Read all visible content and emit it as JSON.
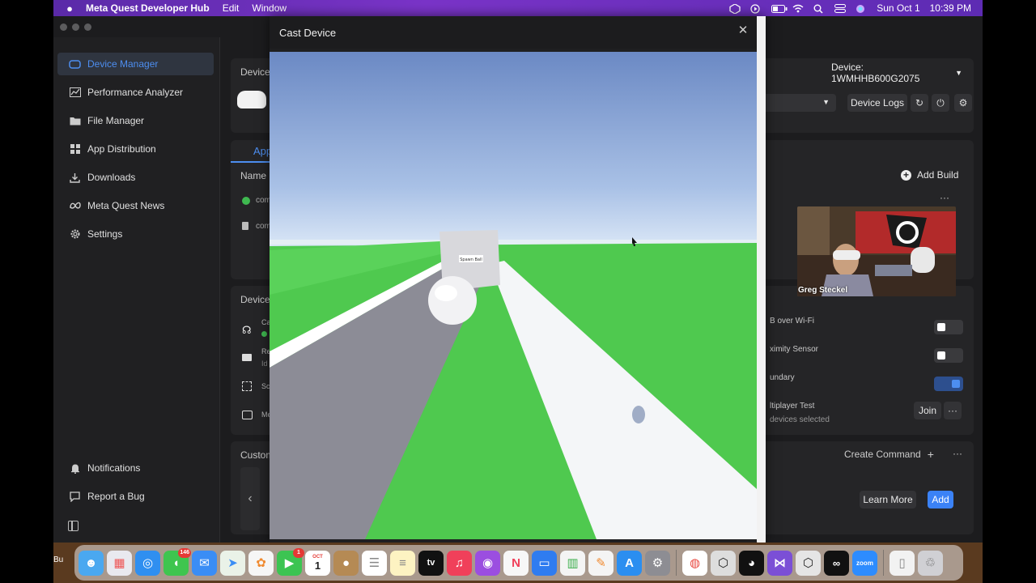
{
  "menubar": {
    "app_name": "Meta Quest Developer Hub",
    "menus": [
      "Edit",
      "Window"
    ],
    "date": "Sun Oct 1",
    "time": "10:39 PM"
  },
  "sidebar": {
    "items": [
      {
        "label": "Device Manager",
        "icon": "headset-icon",
        "active": true
      },
      {
        "label": "Performance Analyzer",
        "icon": "chart-icon"
      },
      {
        "label": "File Manager",
        "icon": "folder-icon"
      },
      {
        "label": "App Distribution",
        "icon": "grid-icon"
      },
      {
        "label": "Downloads",
        "icon": "download-icon"
      },
      {
        "label": "Meta Quest News",
        "icon": "meta-icon"
      },
      {
        "label": "Settings",
        "icon": "gear-icon"
      }
    ],
    "bottom_items": [
      {
        "label": "Notifications",
        "icon": "bell-icon"
      },
      {
        "label": "Report a Bug",
        "icon": "bug-icon"
      }
    ]
  },
  "device_header": {
    "label": "Device",
    "device_select": "Device: 1WMHHB600G2075",
    "device_logs": "Device Logs"
  },
  "apps_panel": {
    "tab_label": "App",
    "column_name": "Name",
    "rows": [
      "com",
      "com"
    ],
    "add_build": "Add Build"
  },
  "device_actions": {
    "label": "Device",
    "rows": [
      {
        "label": "Ca",
        "icon": "cast-icon"
      },
      {
        "label": "Re",
        "sub": "Id",
        "icon": "record-icon"
      },
      {
        "label": "Sc",
        "icon": "screenshot-icon"
      },
      {
        "label": "Me",
        "icon": "media-icon"
      }
    ]
  },
  "settings_rows": {
    "adb_wifi": "B over Wi-Fi",
    "proximity": "ximity Sensor",
    "boundary": "undary",
    "multiplayer": "ltiplayer Test",
    "multiplayer_sub": "devices selected",
    "join": "Join",
    "toggles": [
      false,
      false,
      true
    ]
  },
  "custom_commands": {
    "label": "Custom",
    "create_command": "Create Command",
    "learn_more": "Learn More",
    "add": "Add"
  },
  "cast_modal": {
    "title": "Cast Device",
    "sign_text": "Spawn Ball"
  },
  "webcam": {
    "name": "Greg Steckel"
  },
  "dock": {
    "left_label": "Bu",
    "calendar_month": "OCT",
    "calendar_day": "1",
    "messages_badge": "146",
    "facetime_badge": "1",
    "tv_label": "tv",
    "zoom_label": "zoom"
  },
  "colors": {
    "accent": "#4d8ef0",
    "primary_button": "#3b82f6",
    "menubar": "#6a30bb",
    "sky": "#7fa0d6",
    "grass": "#4fc94f"
  }
}
